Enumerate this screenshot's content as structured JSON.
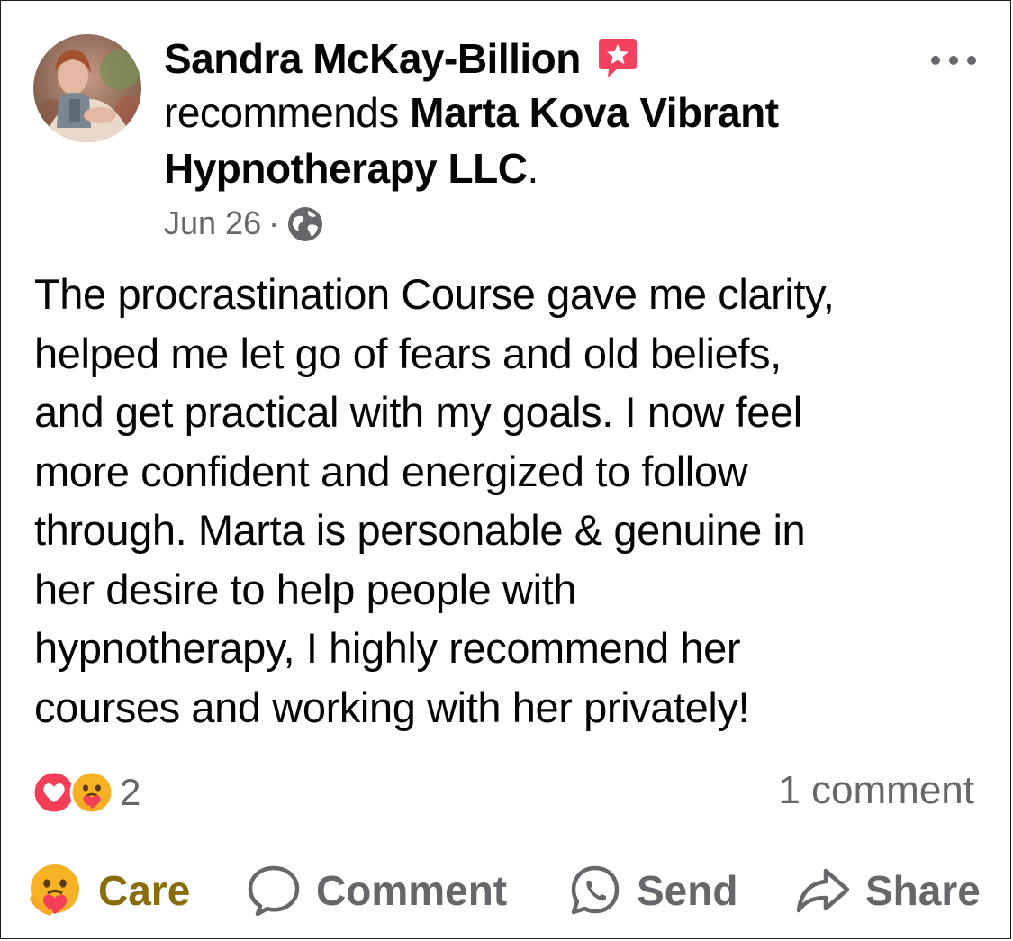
{
  "post": {
    "author": "Sandra McKay-Billion",
    "recommends_prefix": "recommends",
    "page_name": "Marta Kova Vibrant Hypnotherapy LLC",
    "page_name_suffix": ".",
    "date": "Jun 26",
    "separator": "·",
    "body": "The procrastination Course gave me clarity,\nhelped me let go of fears and old beliefs,\nand get practical with my goals.   I now feel\nmore confident and energized to follow\nthrough.  Marta is personable & genuine in\nher desire to help people with\nhypnotherapy, I highly recommend her\ncourses and working with her privately!",
    "reaction_count": "2",
    "comments_label": "1 comment"
  },
  "icons": {
    "badge": "recommendation-star-icon",
    "privacy": "globe-icon",
    "more": "more-options-icon",
    "reaction_love": "love-reaction-icon",
    "reaction_care": "care-reaction-icon"
  },
  "actions": {
    "care_label": "Care",
    "comment_label": "Comment",
    "send_label": "Send",
    "share_label": "Share"
  },
  "colors": {
    "text": "#050505",
    "secondary": "#65676b",
    "care_active": "#8a6d0b",
    "recommend_badge": "#f3425f"
  }
}
